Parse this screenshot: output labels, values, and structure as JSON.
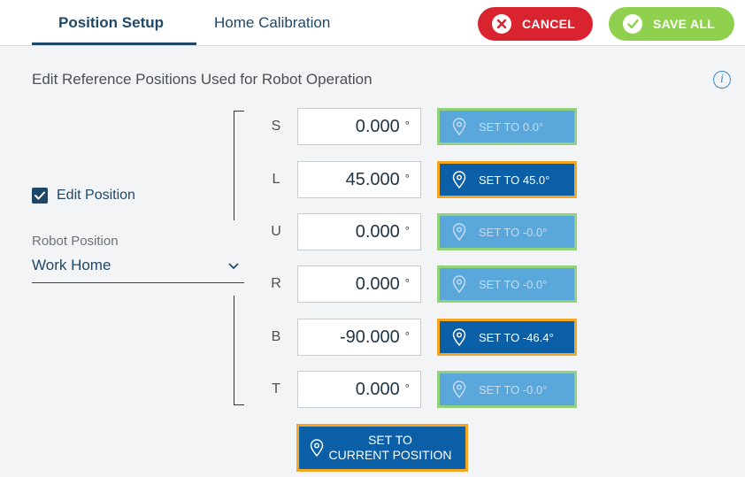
{
  "tabs": [
    {
      "label": "Position Setup",
      "active": true
    },
    {
      "label": "Home Calibration",
      "active": false
    }
  ],
  "actions": {
    "cancel_label": "CANCEL",
    "save_label": "SAVE ALL"
  },
  "heading": "Edit Reference Positions Used for Robot Operation",
  "edit_position": {
    "label": "Edit Position",
    "checked": true
  },
  "robot_position": {
    "label": "Robot Position",
    "value": "Work Home"
  },
  "axes": [
    {
      "axis": "S",
      "value": "0.000",
      "unit": "°",
      "set_label": "SET TO  0.0°",
      "enabled": false
    },
    {
      "axis": "L",
      "value": "45.000",
      "unit": "°",
      "set_label": "SET TO  45.0°",
      "enabled": true
    },
    {
      "axis": "U",
      "value": "0.000",
      "unit": "°",
      "set_label": "SET TO  -0.0°",
      "enabled": false
    },
    {
      "axis": "R",
      "value": "0.000",
      "unit": "°",
      "set_label": "SET TO  -0.0°",
      "enabled": false
    },
    {
      "axis": "B",
      "value": "-90.000",
      "unit": "°",
      "set_label": "SET TO  -46.4°",
      "enabled": true
    },
    {
      "axis": "T",
      "value": "0.000",
      "unit": "°",
      "set_label": "SET TO  -0.0°",
      "enabled": false
    }
  ],
  "set_current": {
    "line1": "SET TO",
    "line2": "CURRENT POSITION"
  },
  "colors": {
    "primary": "#1f4767",
    "cancel": "#d9232f",
    "save": "#8fd14f",
    "button_active": "#0a5fa6",
    "button_active_border": "#f5a623",
    "button_disabled": "#5aa7dc",
    "button_disabled_border": "#92d27a"
  },
  "icons": {
    "cancel": "x-circle-icon",
    "save": "check-circle-icon",
    "info": "info-icon",
    "pin": "location-pin-icon",
    "dropdown": "chevron-down-icon"
  }
}
